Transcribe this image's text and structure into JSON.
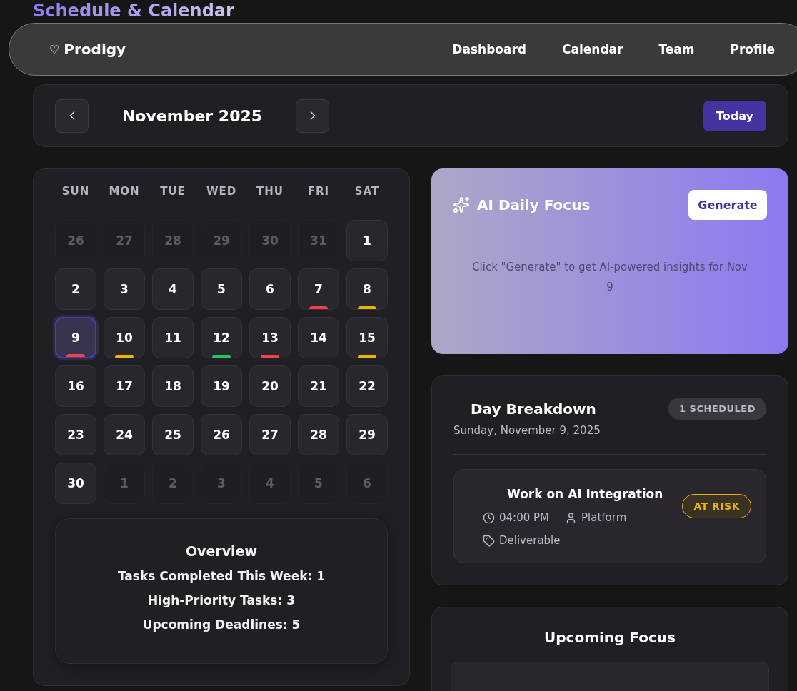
{
  "page_title": "Schedule & Calendar",
  "nav": {
    "brand_icon": "♡",
    "brand": "Prodigy",
    "links": [
      {
        "label": "Dashboard",
        "selected": false
      },
      {
        "label": "Calendar",
        "selected": false
      },
      {
        "label": "Team",
        "selected": false
      },
      {
        "label": "Profile",
        "selected": false
      }
    ]
  },
  "month_bar": {
    "title": "November 2025",
    "today_button": "Today"
  },
  "calendar": {
    "weekdays": [
      "SUN",
      "MON",
      "TUE",
      "WED",
      "THU",
      "FRI",
      "SAT"
    ],
    "days": [
      {
        "label": "26",
        "outside": true,
        "selected": false
      },
      {
        "label": "27",
        "outside": true,
        "selected": false
      },
      {
        "label": "28",
        "outside": true,
        "selected": false
      },
      {
        "label": "29",
        "outside": true,
        "selected": false
      },
      {
        "label": "30",
        "outside": true,
        "selected": false
      },
      {
        "label": "31",
        "outside": true,
        "selected": false
      },
      {
        "label": "1",
        "outside": false,
        "selected": false
      },
      {
        "label": "2",
        "outside": false,
        "selected": false
      },
      {
        "label": "3",
        "outside": false,
        "selected": false
      },
      {
        "label": "4",
        "outside": false,
        "selected": false
      },
      {
        "label": "5",
        "outside": false,
        "selected": false
      },
      {
        "label": "6",
        "outside": false,
        "selected": false
      },
      {
        "label": "7",
        "outside": false,
        "selected": false,
        "color": "#ef4444"
      },
      {
        "label": "8",
        "outside": false,
        "selected": false,
        "color": "#eab308"
      },
      {
        "label": "9",
        "outside": false,
        "selected": true,
        "color": "#ef4444"
      },
      {
        "label": "10",
        "outside": false,
        "selected": false,
        "color": "#eab308"
      },
      {
        "label": "11",
        "outside": false,
        "selected": false
      },
      {
        "label": "12",
        "outside": false,
        "selected": false,
        "color": "#22c55e"
      },
      {
        "label": "13",
        "outside": false,
        "selected": false,
        "color": "#ef4444"
      },
      {
        "label": "14",
        "outside": false,
        "selected": false
      },
      {
        "label": "15",
        "outside": false,
        "selected": false,
        "color": "#eab308"
      },
      {
        "label": "16",
        "outside": false,
        "selected": false
      },
      {
        "label": "17",
        "outside": false,
        "selected": false
      },
      {
        "label": "18",
        "outside": false,
        "selected": false
      },
      {
        "label": "19",
        "outside": false,
        "selected": false
      },
      {
        "label": "20",
        "outside": false,
        "selected": false
      },
      {
        "label": "21",
        "outside": false,
        "selected": false
      },
      {
        "label": "22",
        "outside": false,
        "selected": false
      },
      {
        "label": "23",
        "outside": false,
        "selected": false
      },
      {
        "label": "24",
        "outside": false,
        "selected": false
      },
      {
        "label": "25",
        "outside": false,
        "selected": false
      },
      {
        "label": "26",
        "outside": false,
        "selected": false
      },
      {
        "label": "27",
        "outside": false,
        "selected": false
      },
      {
        "label": "28",
        "outside": false,
        "selected": false
      },
      {
        "label": "29",
        "outside": false,
        "selected": false
      },
      {
        "label": "30",
        "outside": false,
        "selected": false
      },
      {
        "label": "1",
        "outside": true,
        "selected": false
      },
      {
        "label": "2",
        "outside": true,
        "selected": false
      },
      {
        "label": "3",
        "outside": true,
        "selected": false
      },
      {
        "label": "4",
        "outside": true,
        "selected": false
      },
      {
        "label": "5",
        "outside": true,
        "selected": false
      },
      {
        "label": "6",
        "outside": true,
        "selected": false
      }
    ]
  },
  "overview": {
    "title": "Overview",
    "stats": [
      "Tasks Completed This Week: 1",
      "High-Priority Tasks: 3",
      "Upcoming Deadlines: 5"
    ]
  },
  "ai_focus": {
    "title": "AI Daily Focus",
    "button": "Generate",
    "hint": "Click \"Generate\" to get AI-powered insights for Nov 9"
  },
  "day_breakdown": {
    "title": "Day Breakdown",
    "badge": "1 SCHEDULED",
    "date": "Sunday, November 9, 2025",
    "tasks": [
      {
        "title": "Work on AI Integration",
        "time": "04:00 PM",
        "owner": "Platform",
        "tag": "Deliverable",
        "status": "AT RISK",
        "color": "#eab308"
      }
    ]
  },
  "upcoming": {
    "title": "Upcoming Focus"
  }
}
